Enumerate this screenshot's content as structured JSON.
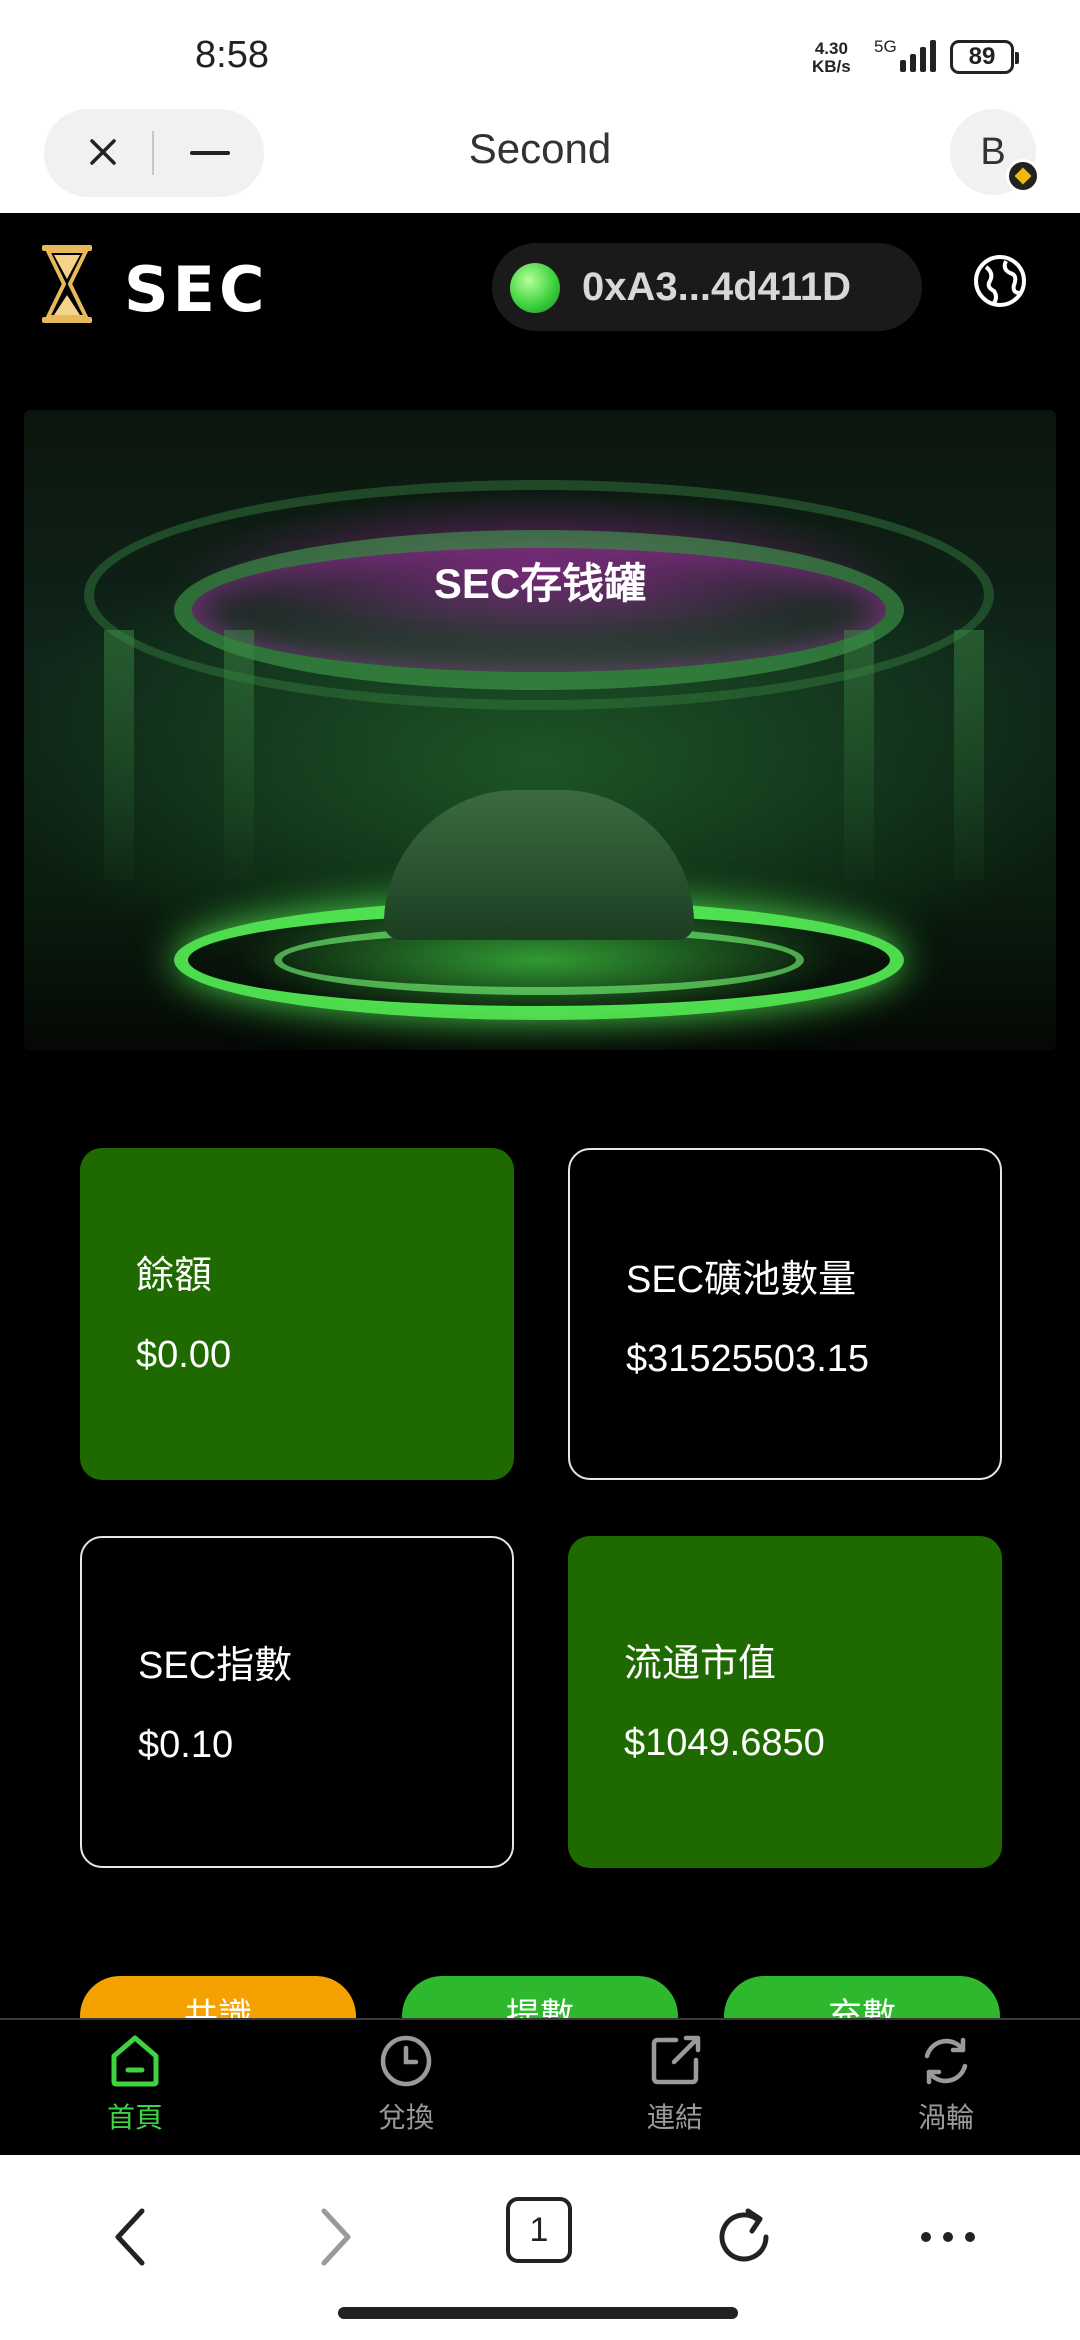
{
  "status_bar": {
    "time": "8:58",
    "net_speed_value": "4.30",
    "net_speed_unit": "KB/s",
    "network_type": "5G",
    "battery": "89"
  },
  "browser": {
    "title": "Second",
    "avatar_initial": "B",
    "tab_count": "1"
  },
  "app": {
    "brand": "SEC",
    "wallet_address": "0xA3...4d411D"
  },
  "hero": {
    "title": "SEC存钱罐"
  },
  "stats": [
    {
      "label": "餘額",
      "value": "$0.00"
    },
    {
      "label": "SEC礦池數量",
      "value": "$31525503.15"
    },
    {
      "label": "SEC指數",
      "value": "$0.10"
    },
    {
      "label": "流通市值",
      "value": "$1049.6850"
    }
  ],
  "actions": [
    {
      "label": "共識",
      "color": "#f5a100"
    },
    {
      "label": "提數",
      "color": "#2db82d"
    },
    {
      "label": "充數",
      "color": "#2db82d"
    }
  ],
  "nav": [
    {
      "label": "首頁",
      "icon": "home-icon",
      "active": true
    },
    {
      "label": "兌換",
      "icon": "clock-icon",
      "active": false
    },
    {
      "label": "連結",
      "icon": "link-icon",
      "active": false
    },
    {
      "label": "渦輪",
      "icon": "refresh-icon",
      "active": false
    }
  ],
  "colors": {
    "accent_green": "#3fd33f",
    "card_green": "#1f6a00",
    "orange": "#f5a100",
    "background": "#000000"
  }
}
